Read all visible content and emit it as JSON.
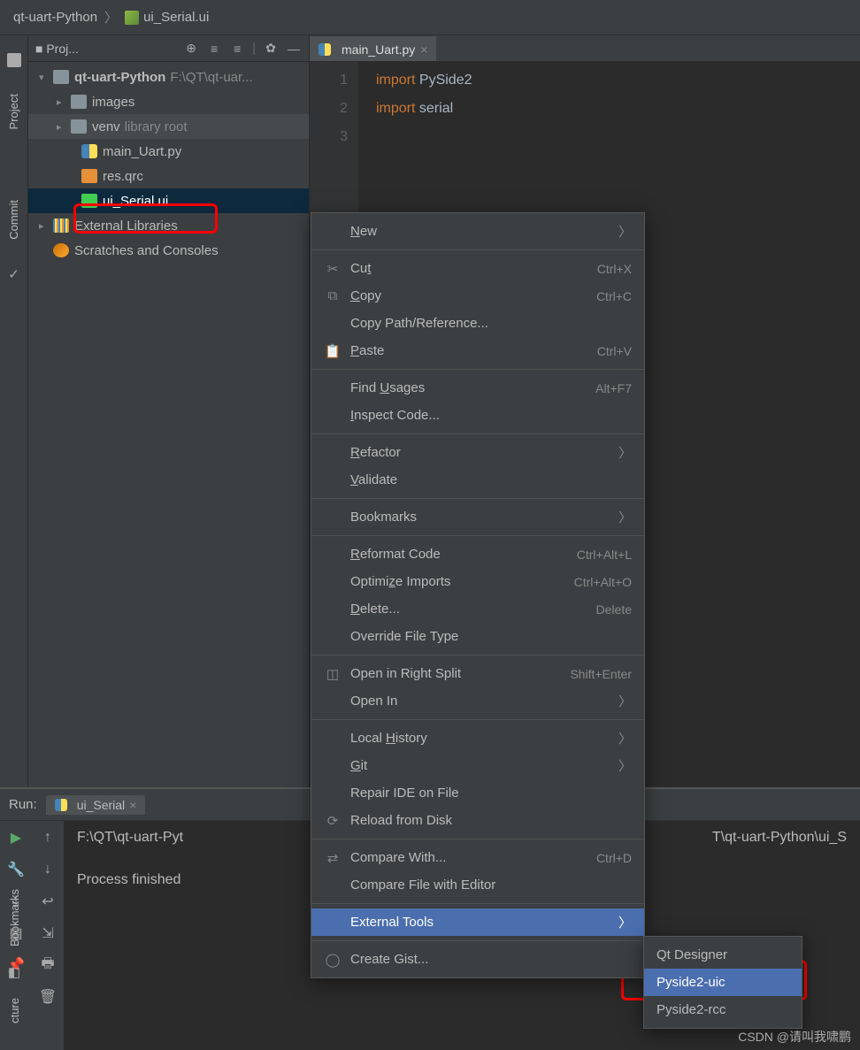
{
  "breadcrumb": {
    "root": "qt-uart-Python",
    "file": "ui_Serial.ui"
  },
  "sidebar_rails": {
    "project": "Project",
    "commit": "Commit",
    "bookmarks": "Bookmarks",
    "structure": "cture"
  },
  "project_panel": {
    "title": "■ Proj...",
    "tree": {
      "root": "qt-uart-Python",
      "root_path": "F:\\QT\\qt-uar...",
      "images": "images",
      "venv": "venv",
      "venv_note": "library root",
      "main": "main_Uart.py",
      "res": "res.qrc",
      "ui": "ui_Serial.ui",
      "ext_lib": "External Libraries",
      "scratches": "Scratches and Consoles"
    }
  },
  "editor": {
    "tab_label": "main_Uart.py",
    "lines": [
      "import PySide2",
      "import serial",
      ""
    ],
    "line_nums": [
      "1",
      "2",
      "3"
    ]
  },
  "context_menu": {
    "new": "New",
    "cut": "Cut",
    "cut_sc": "Ctrl+X",
    "copy": "Copy",
    "copy_sc": "Ctrl+C",
    "copy_path": "Copy Path/Reference...",
    "paste": "Paste",
    "paste_sc": "Ctrl+V",
    "find_usages": "Find Usages",
    "find_sc": "Alt+F7",
    "inspect": "Inspect Code...",
    "refactor": "Refactor",
    "validate": "Validate",
    "bookmarks": "Bookmarks",
    "reformat": "Reformat Code",
    "reformat_sc": "Ctrl+Alt+L",
    "optimize": "Optimize Imports",
    "optimize_sc": "Ctrl+Alt+O",
    "delete": "Delete...",
    "delete_sc": "Delete",
    "override": "Override File Type",
    "open_split": "Open in Right Split",
    "open_split_sc": "Shift+Enter",
    "open_in": "Open In",
    "local_hist": "Local History",
    "git": "Git",
    "repair": "Repair IDE on File",
    "reload": "Reload from Disk",
    "compare_with": "Compare With...",
    "compare_sc": "Ctrl+D",
    "compare_editor": "Compare File with Editor",
    "external_tools": "External Tools",
    "create_gist": "Create Gist..."
  },
  "submenu": {
    "designer": "Qt Designer",
    "uic": "Pyside2-uic",
    "rcc": "Pyside2-rcc"
  },
  "run_panel": {
    "label": "Run:",
    "tab": "ui_Serial",
    "cmd_line": "F:\\QT\\qt-uart-Pyt",
    "cmd_line_tail": "T\\qt-uart-Python\\ui_S",
    "finished": "Process finished"
  },
  "watermark": "CSDN @请叫我啸鹏"
}
